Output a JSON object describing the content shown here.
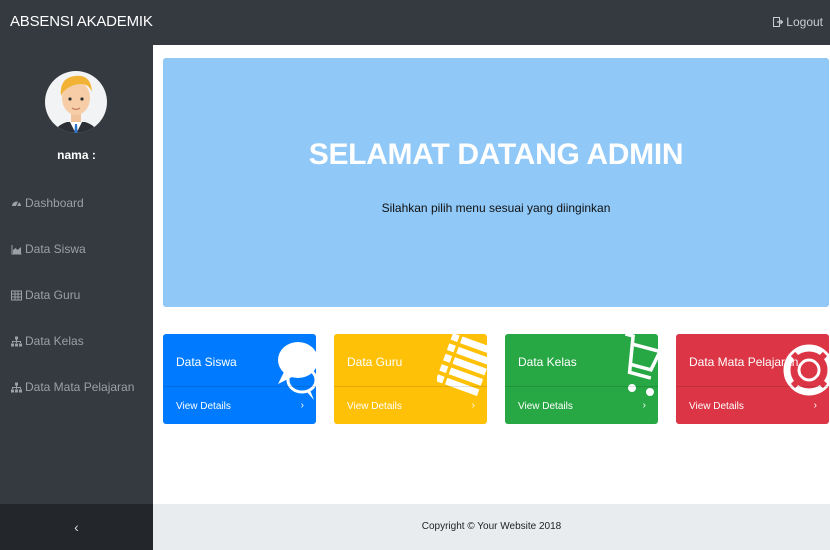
{
  "header": {
    "brand": "ABSENSI AKADEMIK",
    "logout_label": "Logout"
  },
  "sidebar": {
    "user_label": "nama :",
    "items": [
      {
        "label": "Dashboard",
        "icon": "dashboard-icon"
      },
      {
        "label": "Data Siswa",
        "icon": "area-chart-icon"
      },
      {
        "label": "Data Guru",
        "icon": "table-icon"
      },
      {
        "label": "Data Kelas",
        "icon": "sitemap-icon"
      },
      {
        "label": "Data Mata Pelajaran",
        "icon": "sitemap-icon"
      }
    ],
    "toggle": "‹"
  },
  "jumbotron": {
    "title": "SELAMAT DATANG ADMIN",
    "subtitle": "Silahkan pilih menu sesuai yang diinginkan"
  },
  "cards": [
    {
      "title": "Data Siswa",
      "link": "View Details",
      "color": "#007bff",
      "icon": "comments-icon"
    },
    {
      "title": "Data Guru",
      "link": "View Details",
      "color": "#ffc107",
      "icon": "list-icon"
    },
    {
      "title": "Data Kelas",
      "link": "View Details",
      "color": "#28a745",
      "icon": "shopping-cart-icon"
    },
    {
      "title": "Data Mata Pelajaran",
      "link": "View Details",
      "color": "#dc3545",
      "icon": "life-ring-icon"
    }
  ],
  "footer": {
    "copyright": "Copyright © Your Website 2018"
  }
}
